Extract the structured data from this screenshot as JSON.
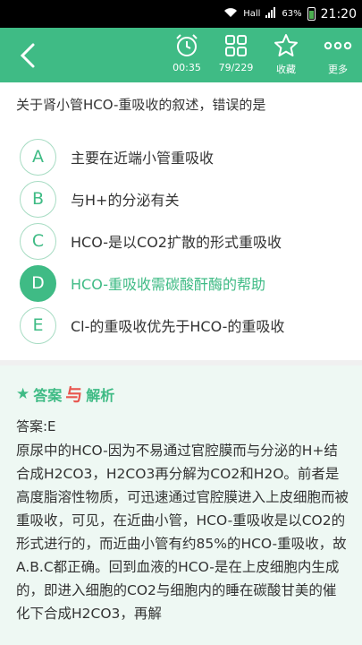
{
  "status": {
    "signal": "Hall",
    "battery": "63%",
    "time": "21:20"
  },
  "toolbar": {
    "timer": "00:35",
    "progress": "79/229",
    "favorite": "收藏",
    "more": "更多"
  },
  "question": "关于肾小管HCO-重吸收的叙述，错误的是",
  "options": [
    {
      "letter": "A",
      "text": "主要在近端小管重吸收"
    },
    {
      "letter": "B",
      "text": "与H+的分泌有关"
    },
    {
      "letter": "C",
      "text": "HCO-是以CO2扩散的形式重吸收"
    },
    {
      "letter": "D",
      "text": "HCO-重吸收需碳酸酐酶的帮助"
    },
    {
      "letter": "E",
      "text": "Cl-的重吸收优先于HCO-的重吸收"
    }
  ],
  "selected_option": "D",
  "answer": {
    "title_part1": "答案",
    "title_accent": "与",
    "title_part2": "解析",
    "label": "答案:E",
    "analysis": "原尿中的HCO-因为不易通过官腔膜而与分泌的H+结合成H2CO3，H2CO3再分解为CO2和H2O。前者是高度脂溶性物质，可迅速通过官腔膜进入上皮细胞而被重吸收，可见，在近曲小管，HCO-重吸收是以CO2的形式进行的，而近曲小管有约85%的HCO-重吸收，故A.B.C都正确。回到血液的HCO-是在上皮细胞内生成的，即进入细胞的CO2与细胞内的睡在碳酸甘美的催化下合成H2CO3，再解"
  },
  "colors": {
    "accent": "#3fbb85",
    "highlight": "#e8554e"
  }
}
